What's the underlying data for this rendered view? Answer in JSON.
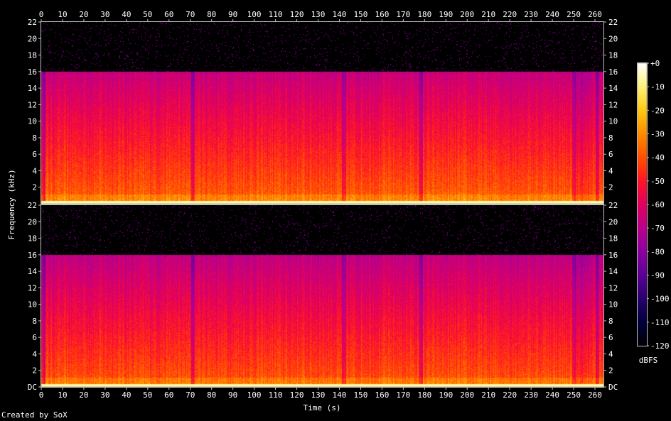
{
  "chart_data": {
    "type": "heatmap",
    "subtype": "spectrogram",
    "channels": 2,
    "xlabel": "Time (s)",
    "ylabel": "Frequency (kHz)",
    "xlim": [
      0,
      264
    ],
    "ylim": [
      0,
      22
    ],
    "x_ticks": [
      "0",
      "10",
      "20",
      "30",
      "40",
      "50",
      "60",
      "70",
      "80",
      "90",
      "100",
      "110",
      "120",
      "130",
      "140",
      "150",
      "160",
      "170",
      "180",
      "190",
      "200",
      "210",
      "220",
      "230",
      "240",
      "250",
      "260"
    ],
    "y_ticks": [
      "DC",
      "2",
      "4",
      "6",
      "8",
      "10",
      "12",
      "14",
      "16",
      "18",
      "20",
      "22"
    ],
    "y_tick_values": [
      0,
      2,
      4,
      6,
      8,
      10,
      12,
      14,
      16,
      18,
      20,
      22
    ],
    "colorbar": {
      "label": "dBFS",
      "ticks": [
        "+0",
        "-10",
        "-20",
        "-30",
        "-40",
        "-50",
        "-60",
        "-70",
        "-80",
        "-90",
        "-100",
        "-110",
        "-120"
      ],
      "tick_values": [
        0,
        -10,
        -20,
        -30,
        -40,
        -50,
        -60,
        -70,
        -80,
        -90,
        -100,
        -110,
        -120
      ],
      "range": [
        -120,
        0
      ]
    },
    "features": {
      "lowpass_cutoff_khz": 16,
      "dropout_times_s": [
        1,
        71,
        142,
        178,
        250,
        261
      ]
    },
    "colors": {
      "background": "#000000",
      "axis": "#c0c0c0",
      "text": "#ffffff"
    }
  },
  "footer": {
    "credit": "Created by SoX"
  }
}
